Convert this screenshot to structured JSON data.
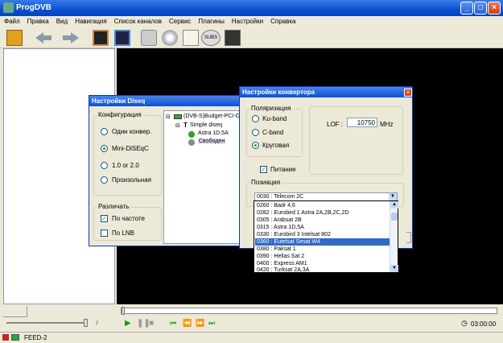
{
  "window": {
    "title": "ProgDVB"
  },
  "menu": [
    "Файл",
    "Правка",
    "Вид",
    "Навигация",
    "Список каналов",
    "Сервис",
    "Плагины",
    "Настройки",
    "Справка"
  ],
  "status": {
    "feed": "FEED-2",
    "time": "03:00:00"
  },
  "diseq": {
    "title": "Настройки Diseq",
    "config_label": "Конфигурация",
    "options": [
      "Один конвер.",
      "Mini-DiSEqC",
      "1.0 or 2.0",
      "Произольная"
    ],
    "selected": 1,
    "distinguish_label": "Различать",
    "by_freq": "По частоте",
    "by_lnb": "По LNB",
    "tree": {
      "root": "(DVB-S)Budget-PCI-C",
      "child": "Simple diseq",
      "sat1": "Astra 1D,5A",
      "sat2": "Свободен"
    }
  },
  "converter": {
    "title": "Настройки конвертора",
    "polarization_label": "Поляризация",
    "pol_options": [
      "Ku-band",
      "C-band",
      "Круговая"
    ],
    "pol_selected": 2,
    "lof_label": "LOF :",
    "lof_value": "10750",
    "lof_unit": "MHz",
    "power_label": "Питание",
    "position_label": "Позиация",
    "position_value": "0030 : Telecom 2C",
    "list": [
      "0260 : Badr 4,6",
      "0282 : Eurobird 1  Astra 2A,2B,2C,2D",
      "0305 : Arabsat 2B",
      "0315 : Astra 1D,5A",
      "0330 : Eurobird 3  Intelsat 802",
      "0360 : Eutelsat Sesat  W4",
      "0380 : Paksat 1",
      "0390 : Hellas Sat 2",
      "0400 : Express AM1",
      "0420 : Turksat 2A,3A"
    ],
    "list_selected": 5
  }
}
